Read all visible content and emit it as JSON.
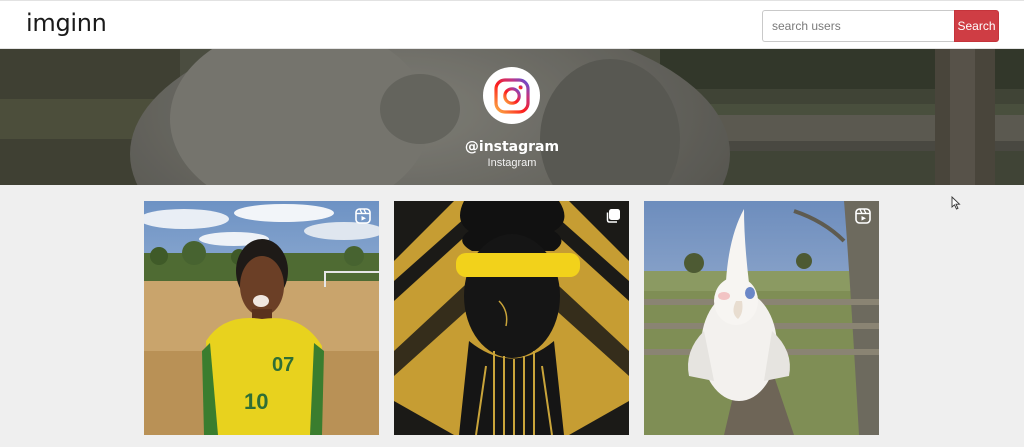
{
  "header": {
    "brand": "imginn",
    "search_placeholder": "search users",
    "search_button": "Search"
  },
  "profile": {
    "handle": "@instagram",
    "name": "Instagram",
    "avatar_icon": "instagram-logo-icon"
  },
  "posts": [
    {
      "type_icon": "reel-icon"
    },
    {
      "type_icon": "carousel-icon"
    },
    {
      "type_icon": "reel-icon"
    }
  ],
  "colors": {
    "search_button": "#cf3d44",
    "page_background": "#efefef",
    "yellow_jersey": "#e8d21e"
  }
}
